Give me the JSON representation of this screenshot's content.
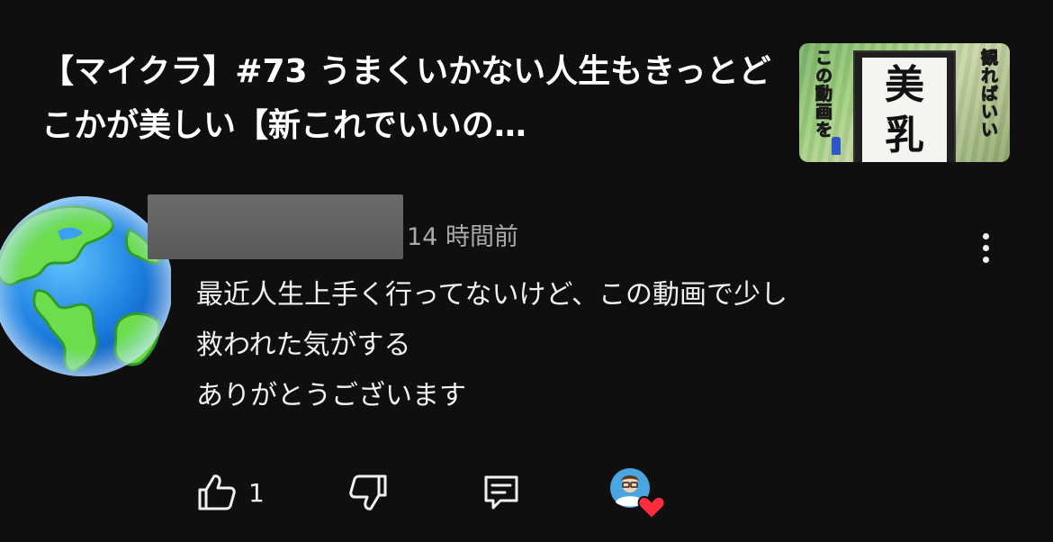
{
  "video": {
    "title": "【マイクラ】#73 うまくいかない人生もきっとどこかが美しい【新これでいいの…",
    "thumbnail": {
      "left_text": "この動画を",
      "right_text": "観ればいい",
      "center_line1": "美",
      "center_line2": "乳"
    }
  },
  "comment": {
    "timestamp": "14 時間前",
    "lines": [
      "最近人生上手く行ってないけど、この動画で少し",
      "救われた気がする",
      "ありがとうございます"
    ]
  },
  "actions": {
    "like_count": "1"
  },
  "icons": {
    "avatar": "globe-americas-icon",
    "more": "vertical-ellipsis-icon",
    "like": "thumbs-up-icon",
    "dislike": "thumbs-down-icon",
    "reply": "comment-icon",
    "creator_heart": "creator-heart-icon"
  },
  "colors": {
    "background": "#0f0f0f",
    "text": "#f1f1f1",
    "secondary_text": "#aaaaaa",
    "heart": "#ff2d3c"
  }
}
